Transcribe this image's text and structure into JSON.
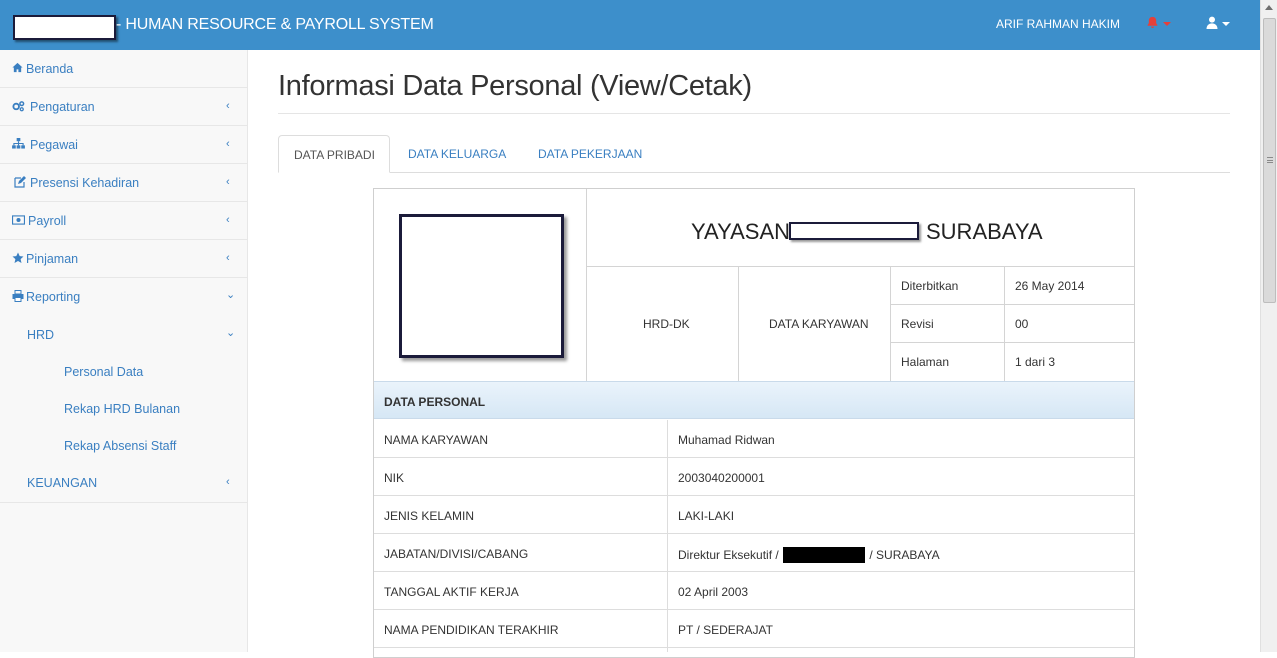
{
  "navbar": {
    "brand_prefix": "- ",
    "brand_title": "HUMAN RESOURCE & PAYROLL SYSTEM",
    "user_name": "ARIF RAHMAN HAKIM",
    "bell_icon": "bell-icon",
    "user_icon": "user-icon",
    "color": "#3d8fcb"
  },
  "sidebar": {
    "items": [
      {
        "label": "Beranda",
        "icon": "home-icon"
      },
      {
        "label": "Pengaturan",
        "icon": "gears-icon"
      },
      {
        "label": "Pegawai",
        "icon": "sitemap-icon"
      },
      {
        "label": "Presensi Kehadiran",
        "icon": "edit-icon"
      },
      {
        "label": "Payroll",
        "icon": "money-icon"
      },
      {
        "label": "Pinjaman",
        "icon": "star-icon"
      },
      {
        "label": "Reporting",
        "icon": "print-icon"
      }
    ],
    "sub": {
      "hrd": "HRD",
      "personal_data": "Personal Data",
      "rekap_hrd": "Rekap HRD Bulanan",
      "rekap_absensi": "Rekap Absensi Staff",
      "keuangan": "KEUANGAN"
    },
    "chevron_left": "‹",
    "chevron_down": "⌄"
  },
  "main": {
    "title": "Informasi Data Personal (View/Cetak)",
    "tabs": [
      {
        "label": "DATA PRIBADI",
        "active": true
      },
      {
        "label": "DATA KELUARGA",
        "active": false
      },
      {
        "label": "DATA PEKERJAAN",
        "active": false
      }
    ]
  },
  "sheet": {
    "org_prefix": "YAYASAN",
    "org_city": "SURABAYA",
    "code": "HRD-DK",
    "doc_type": "DATA KARYAWAN",
    "meta": [
      {
        "label": "Diterbitkan",
        "value": "26 May 2014"
      },
      {
        "label": "Revisi",
        "value": "00"
      },
      {
        "label": "Halaman",
        "value": "1 dari 3"
      }
    ],
    "section_title": "DATA PERSONAL",
    "rows": [
      {
        "label": "NAMA KARYAWAN",
        "value": "Muhamad Ridwan"
      },
      {
        "label": "NIK",
        "value": "2003040200001"
      },
      {
        "label": "JENIS KELAMIN",
        "value": "LAKI-LAKI"
      },
      {
        "label": "JABATAN/DIVISI/CABANG",
        "value_prefix": "Direktur Eksekutif / ",
        "value_suffix": " / SURABAYA"
      },
      {
        "label": "TANGGAL AKTIF KERJA",
        "value": "02 April 2003"
      },
      {
        "label": "NAMA PENDIDIKAN TERAKHIR",
        "value": "PT / SEDERAJAT"
      }
    ]
  }
}
